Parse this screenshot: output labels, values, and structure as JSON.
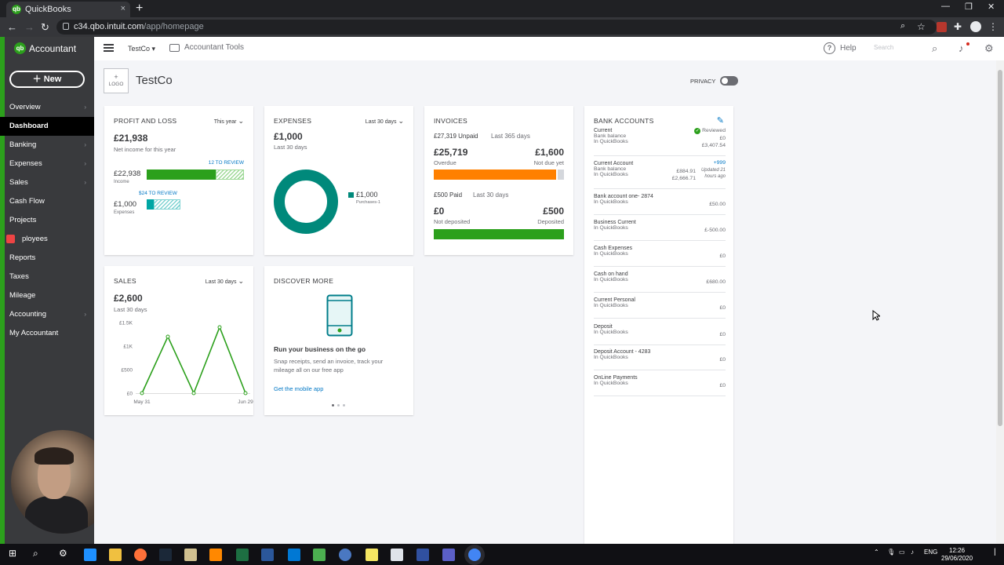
{
  "browser": {
    "tab_title": "QuickBooks",
    "tab_close": "×",
    "new_tab": "+",
    "url_host": "c34.qbo.intuit.com",
    "url_path": "/app/homepage"
  },
  "sidebar": {
    "brand": "Accountant",
    "brand_icon": "qb",
    "new_label": "New",
    "items": [
      {
        "label": "Overview",
        "chevron": "›"
      },
      {
        "label": "Dashboard",
        "chevron": ""
      },
      {
        "label": "Banking",
        "chevron": "›"
      },
      {
        "label": "Expenses",
        "chevron": "›"
      },
      {
        "label": "Sales",
        "chevron": "›"
      },
      {
        "label": "Cash Flow",
        "chevron": ""
      },
      {
        "label": "Projects",
        "chevron": ""
      },
      {
        "label": "ployees",
        "chevron": ""
      },
      {
        "label": "Reports",
        "chevron": ""
      },
      {
        "label": "Taxes",
        "chevron": ""
      },
      {
        "label": "Mileage",
        "chevron": ""
      },
      {
        "label": "Accounting",
        "chevron": "›"
      },
      {
        "label": "My Accountant",
        "chevron": ""
      }
    ]
  },
  "topbar": {
    "company": "TestCo",
    "company_chevron": "▾",
    "accountant_tools": "Accountant Tools",
    "help": "Help",
    "help_icon": "?",
    "search_placeholder": "Search"
  },
  "header": {
    "logo_plus": "+",
    "logo_label": "LOGO",
    "company_name": "TestCo",
    "privacy": "PRIVACY"
  },
  "profit_loss": {
    "title": "PROFIT AND LOSS",
    "period": "This year",
    "amount": "£21,938",
    "subtitle": "Net income for this year",
    "income_review": "12 TO REVIEW",
    "income_amount": "£22,938",
    "income_label": "Income",
    "expenses_review": "$24 TO REVIEW",
    "expenses_amount": "£1,000",
    "expenses_label": "Expenses"
  },
  "expenses": {
    "title": "EXPENSES",
    "period": "Last 30 days",
    "amount": "£1,000",
    "subtitle": "Last 30 days",
    "legend_amount": "£1,000",
    "legend_label": "Purchases-1",
    "color": "#00897b"
  },
  "invoices": {
    "title": "INVOICES",
    "unpaid": "£27,319 Unpaid",
    "unpaid_period": "Last 365 days",
    "overdue_amount": "£25,719",
    "overdue_label": "Overdue",
    "not_due_amount": "£1,600",
    "not_due_label": "Not due yet",
    "paid": "£500 Paid",
    "paid_period": "Last 30 days",
    "not_deposited_amount": "£0",
    "not_deposited_label": "Not deposited",
    "deposited_amount": "£500",
    "deposited_label": "Deposited",
    "overdue_color": "#ff8000",
    "deposited_color": "#2ca01c"
  },
  "bank": {
    "title": "BANK ACCOUNTS",
    "edit_icon": "✎",
    "accounts": [
      {
        "name": "Current",
        "status": "Reviewed",
        "line1": "Bank balance",
        "val1": "£0",
        "line2": "In QuickBooks",
        "val2": "£3,407.54"
      },
      {
        "name": "Current Account",
        "status": "+999",
        "line1": "Bank balance",
        "val1": "£884.91",
        "line2": "In QuickBooks",
        "val2": "£2,666.71",
        "note1": "Updated 21",
        "note2": "hours ago"
      },
      {
        "name": "Bank account one- 2874",
        "line2": "In QuickBooks",
        "val2": "£50.00"
      },
      {
        "name": "Business Current",
        "line2": "In QuickBooks",
        "val2": "£-500.00"
      },
      {
        "name": "Cash Expenses",
        "line2": "In QuickBooks",
        "val2": "£0"
      },
      {
        "name": "Cash on hand",
        "line2": "In QuickBooks",
        "val2": "£680.00"
      },
      {
        "name": "Current Personal",
        "line2": "In QuickBooks",
        "val2": "£0"
      },
      {
        "name": "Deposit",
        "line2": "In QuickBooks",
        "val2": "£0"
      },
      {
        "name": "Deposit Account - 4283",
        "line2": "In QuickBooks",
        "val2": "£0"
      },
      {
        "name": "OnLine Payments",
        "line2": "In QuickBooks",
        "val2": "£0"
      }
    ]
  },
  "sales": {
    "title": "SALES",
    "period": "Last 30 days",
    "amount": "£2,600",
    "subtitle": "Last 30 days"
  },
  "discover": {
    "title": "DISCOVER MORE",
    "heading": "Run your business on the go",
    "body1": "Snap receipts, send an invoice, track your",
    "body2": "mileage all on our free app",
    "link": "Get the mobile app"
  },
  "taskbar": {
    "lang": "ENG",
    "time": "12:26",
    "date": "29/06/2020"
  },
  "chart_data": {
    "type": "line",
    "x": [
      "May 31",
      "",
      "",
      "",
      "",
      "Jun 29"
    ],
    "series": [
      {
        "values": [
          0,
          1200,
          0,
          1400,
          0
        ]
      }
    ],
    "y_ticks": [
      "£0",
      "£500",
      "£1K",
      "£1.5K"
    ],
    "ylim": [
      0,
      1500
    ],
    "color": "#2ca01c"
  }
}
